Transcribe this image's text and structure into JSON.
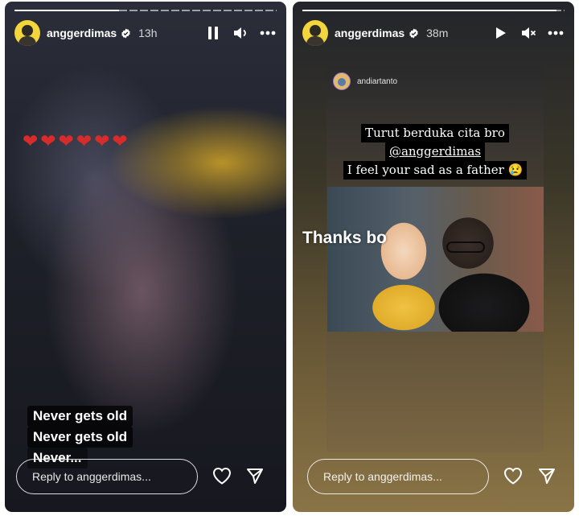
{
  "stories": [
    {
      "username": "anggerdimas",
      "time_ago": "13h",
      "progress_fraction": 0.4,
      "hearts": "❤❤❤❤❤❤",
      "captions": [
        "Never gets old",
        "Never gets old",
        "Never..."
      ],
      "reply_placeholder": "Reply to anggerdimas...",
      "controls": {
        "primary_icon": "pause-icon",
        "volume_icon": "volume-icon",
        "more_icon": "more-icon"
      }
    },
    {
      "username": "anggerdimas",
      "time_ago": "38m",
      "progress_fraction": 0.97,
      "reshared_from": "andiartanto",
      "condolence_lines": [
        "Turut berduka cita bro",
        "@anggerdimas",
        "I feel your sad as a father 😢"
      ],
      "overlay_text": "Thanks bo",
      "reply_placeholder": "Reply to anggerdimas...",
      "controls": {
        "primary_icon": "play-icon",
        "volume_icon": "muted-icon",
        "more_icon": "more-icon"
      }
    }
  ],
  "colors": {
    "accent_avatar": "#f3d53c",
    "heart": "#d82c2c"
  }
}
